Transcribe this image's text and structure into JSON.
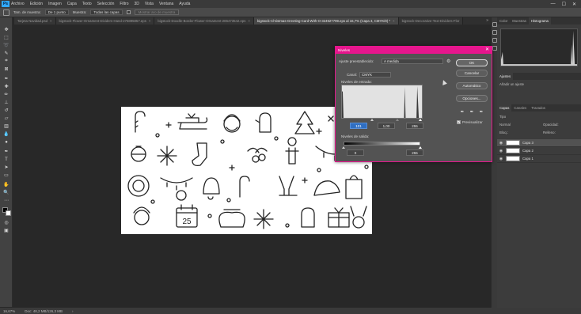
{
  "menu": {
    "logo": "Ps",
    "items": [
      "Archivo",
      "Edición",
      "Imagen",
      "Capa",
      "Texto",
      "Selección",
      "Filtro",
      "3D",
      "Vista",
      "Ventana",
      "Ayuda"
    ],
    "win_min": "—",
    "win_max": "☐",
    "win_close": "✕"
  },
  "options": {
    "sample_label": "Tam. de muestra:",
    "sample_value": "De 1 punto",
    "sample_all": "Muestra:",
    "sample_layers": "Todas las capas",
    "show_ring": "Mostrar aro de muestra"
  },
  "tabs": [
    {
      "label": "Tarjeta Navidad.psd",
      "active": false
    },
    {
      "label": "bigstock-Flower-Ornament-Dividers-Hand-276895857.eps",
      "active": false
    },
    {
      "label": "bigstock-Doodle-Border-Flower-Ornament-286473542.eps",
      "active": false
    },
    {
      "label": "bigstock-Christmas-Greeting-Card-With-O-324927799.eps al 16,7% (Capa 3, CMYK/8) *",
      "active": true
    },
    {
      "label": "bigstock-Decorative-Text-Dividers-Flor",
      "active": false
    }
  ],
  "tab_close": "×",
  "tabs_more": "»",
  "status": {
    "zoom": "16,67%",
    "doc": "Doc: 48,2 MB/126,3 MB",
    "arrow": "›"
  },
  "panels": {
    "top_tabs": [
      "Color",
      "Muestras",
      "Histograma"
    ],
    "adjust_tabs": [
      "Ajustes"
    ],
    "adjust_label": "Añadir un ajuste",
    "layer_tabs": [
      "Capas",
      "Canales",
      "Trazados"
    ],
    "layer_kind": "Tipo",
    "layer_mode": "Normal",
    "layer_opacity": "Opacidad:",
    "layer_lock": "Bloq.:",
    "layer_fill": "Relleno:",
    "layers": [
      {
        "name": "Capa 3",
        "selected": true
      },
      {
        "name": "Capa 2",
        "selected": false
      },
      {
        "name": "Capa 1",
        "selected": false
      }
    ]
  },
  "levels": {
    "title": "Niveles",
    "close": "✕",
    "preset_label": "Ajuste preestablecido:",
    "preset_value": "A medida",
    "channel_label": "Canal:",
    "channel_value": "CMYK",
    "input_label": "Niveles de entrada:",
    "input_black": "101",
    "input_gamma": "1,00",
    "input_white": "255",
    "output_label": "Niveles de salida:",
    "output_black": "0",
    "output_white": "255",
    "ok": "OK",
    "cancel": "Cancelar",
    "auto": "Automático",
    "options": "Opciones...",
    "preview": "Previsualizar",
    "preview_checked": true,
    "check_mark": "✓"
  },
  "artboard": {
    "calendar_day": "25"
  },
  "colors": {
    "accent": "#e6168d",
    "highlight": "#2f6fc3",
    "ps_blue": "#31a8ff"
  }
}
